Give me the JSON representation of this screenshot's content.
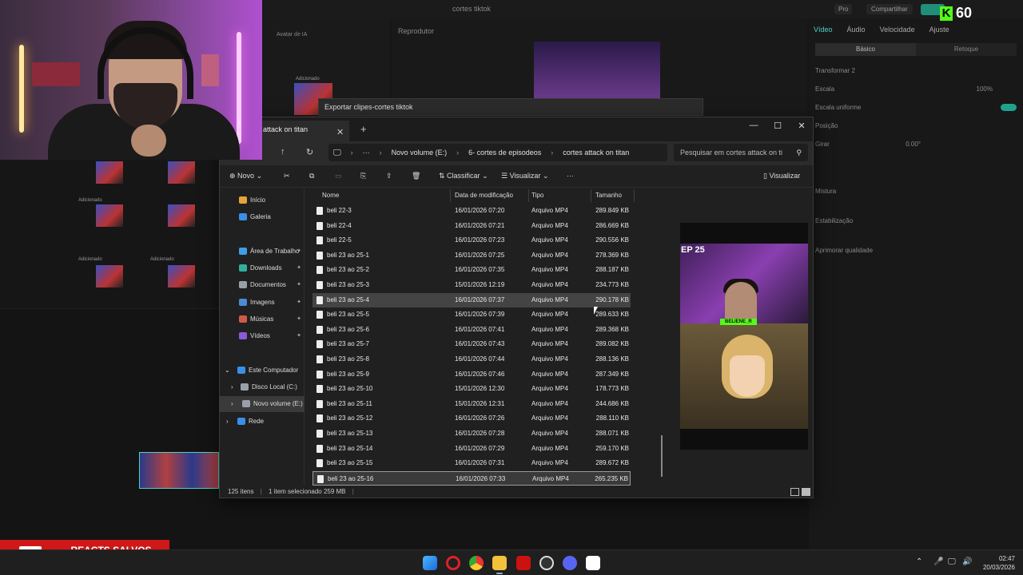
{
  "editor": {
    "title": "cortes tiktok",
    "pro": "Pro",
    "share": "Compartilhar",
    "player_label": "Reprodutor",
    "media_tab": "Avatar de IA",
    "right_tabs": [
      "Vídeo",
      "Áudio",
      "Velocidade",
      "Ajuste"
    ],
    "sub_tabs": [
      "Básico",
      "Retoque"
    ],
    "props": {
      "transform": "Transformar 2",
      "scale": "Escala",
      "scale_value": "100%",
      "uniform_scale": "Escala uniforme",
      "position": "Posição",
      "rotate": "Girar",
      "rotate_value": "0.00°",
      "mix": "Mistura",
      "stabilize": "Estabilização",
      "enhance": "Aprimorar qualidade"
    },
    "clip_labels": [
      "Adicionado",
      "Adicionado",
      "Adicionado",
      "Adicionado"
    ],
    "export_bar": "Exportar clipes-cortes tiktok"
  },
  "kick": {
    "count": "60"
  },
  "explorer": {
    "tab_title": "attack on titan",
    "breadcrumb": [
      "Novo volume (E:)",
      "6- cortes de episodeos",
      "cortes attack on titan"
    ],
    "search_placeholder": "Pesquisar em cortes attack on ti",
    "toolbar": {
      "new": "Novo",
      "sort": "Classificar",
      "view": "Visualizar",
      "preview": "Visualizar"
    },
    "nav": [
      {
        "label": "Início",
        "color": "#e8a33a"
      },
      {
        "label": "Galeria",
        "color": "#3a8fe8"
      },
      {
        "label": "Área de Trabalho",
        "color": "#3aa0e8",
        "pinned": true
      },
      {
        "label": "Downloads",
        "color": "#2fb0a0",
        "pinned": true
      },
      {
        "label": "Documentos",
        "color": "#9aa0aa",
        "pinned": true
      },
      {
        "label": "Imagens",
        "color": "#4a8ad8",
        "pinned": true
      },
      {
        "label": "Músicas",
        "color": "#d05a4a",
        "pinned": true
      },
      {
        "label": "Vídeos",
        "color": "#8a5ad8",
        "pinned": true
      },
      {
        "label": "Este Computador",
        "color": "#3a8fe8"
      },
      {
        "label": "Disco Local (C:)",
        "color": "#9aa0aa"
      },
      {
        "label": "Novo volume (E:)",
        "color": "#9aa0aa"
      },
      {
        "label": "Rede",
        "color": "#3a8fe8"
      }
    ],
    "columns": [
      "Nome",
      "Data de modificação",
      "Tipo",
      "Tamanho"
    ],
    "files": [
      {
        "name": "beli 22-3",
        "date": "16/01/2026 07:20",
        "type": "Arquivo MP4",
        "size": "289.849 KB"
      },
      {
        "name": "beli 22-4",
        "date": "16/01/2026 07:21",
        "type": "Arquivo MP4",
        "size": "286.669 KB"
      },
      {
        "name": "beli 22-5",
        "date": "16/01/2026 07:23",
        "type": "Arquivo MP4",
        "size": "290.556 KB"
      },
      {
        "name": "beli 23 ao 25-1",
        "date": "16/01/2026 07:25",
        "type": "Arquivo MP4",
        "size": "278.369 KB"
      },
      {
        "name": "beli 23 ao 25-2",
        "date": "16/01/2026 07:35",
        "type": "Arquivo MP4",
        "size": "288.187 KB"
      },
      {
        "name": "beli 23 ao 25-3",
        "date": "15/01/2026 12:19",
        "type": "Arquivo MP4",
        "size": "234.773 KB"
      },
      {
        "name": "beli 23 ao 25-4",
        "date": "16/01/2026 07:37",
        "type": "Arquivo MP4",
        "size": "290.178 KB"
      },
      {
        "name": "beli 23 ao 25-5",
        "date": "16/01/2026 07:39",
        "type": "Arquivo MP4",
        "size": "289.633 KB"
      },
      {
        "name": "beli 23 ao 25-6",
        "date": "16/01/2026 07:41",
        "type": "Arquivo MP4",
        "size": "289.368 KB"
      },
      {
        "name": "beli 23 ao 25-7",
        "date": "16/01/2026 07:43",
        "type": "Arquivo MP4",
        "size": "289.082 KB"
      },
      {
        "name": "beli 23 ao 25-8",
        "date": "16/01/2026 07:44",
        "type": "Arquivo MP4",
        "size": "288.136 KB"
      },
      {
        "name": "beli 23 ao 25-9",
        "date": "16/01/2026 07:46",
        "type": "Arquivo MP4",
        "size": "287.349 KB"
      },
      {
        "name": "beli 23 ao 25-10",
        "date": "15/01/2026 12:30",
        "type": "Arquivo MP4",
        "size": "178.773 KB"
      },
      {
        "name": "beli 23 ao 25-11",
        "date": "15/01/2026 12:31",
        "type": "Arquivo MP4",
        "size": "244.686 KB"
      },
      {
        "name": "beli 23 ao 25-12",
        "date": "16/01/2026 07:26",
        "type": "Arquivo MP4",
        "size": "288.110 KB"
      },
      {
        "name": "beli 23 ao 25-13",
        "date": "16/01/2026 07:28",
        "type": "Arquivo MP4",
        "size": "288.071 KB"
      },
      {
        "name": "beli 23 ao 25-14",
        "date": "16/01/2026 07:29",
        "type": "Arquivo MP4",
        "size": "259.170 KB"
      },
      {
        "name": "beli 23 ao 25-15",
        "date": "16/01/2026 07:31",
        "type": "Arquivo MP4",
        "size": "289.672 KB"
      },
      {
        "name": "beli 23 ao 25-16",
        "date": "16/01/2026 07:33",
        "type": "Arquivo MP4",
        "size": "265.235 KB"
      }
    ],
    "preview_label": "EP 25",
    "preview_tag": "BELIENE_R",
    "status": {
      "count": "125 itens",
      "selected": "1 item selecionado  259 MB"
    }
  },
  "banner": {
    "text": "REACTS SALVOS EM:"
  },
  "taskbar": {
    "time": "02:47",
    "date": "20/03/2026"
  }
}
